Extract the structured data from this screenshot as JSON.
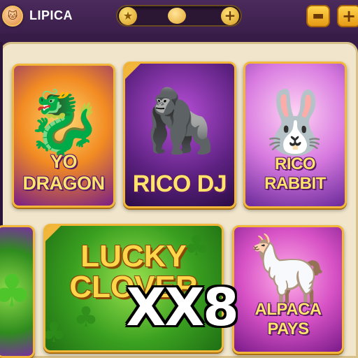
{
  "header": {
    "username": "LIPICA",
    "avatar_icon": "cat-avatar-icon",
    "coin_star_icon": "star-icon",
    "coin_add_label": "+",
    "bag_icon": "bag-icon",
    "add_label": "+"
  },
  "games": [
    {
      "title": "YO DRAGON",
      "art_icon": "dragon-icon"
    },
    {
      "title": "RICO DJ",
      "art_icon": "gorilla-dj-icon"
    },
    {
      "title": "RICO RABBIT",
      "art_icon": "rabbit-icon"
    },
    {
      "title": "",
      "art_icon": "clover-icon"
    },
    {
      "title": "LUCKY CLOVER",
      "art_icon": "clover-icon"
    },
    {
      "title": "ALPACA PAYS",
      "art_icon": "alpaca-icon"
    }
  ],
  "overlay": {
    "multiplier": "XX8"
  },
  "colors": {
    "accent_gold": "#f2b63a",
    "title_yellow": "#ffe36a",
    "panel_bg": "#f1e6cc"
  }
}
